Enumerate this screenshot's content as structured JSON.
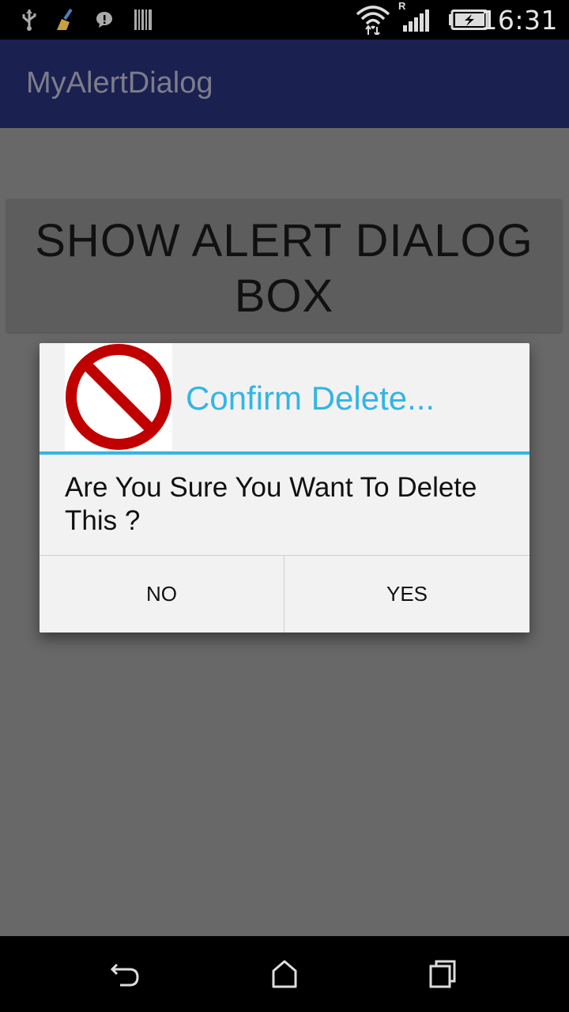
{
  "status_bar": {
    "time": "16:31",
    "roaming_indicator": "R",
    "icons": [
      "usb-icon",
      "cleaner-icon",
      "message-icon",
      "barcode-icon",
      "wifi-icon",
      "signal-icon",
      "battery-charging-icon"
    ]
  },
  "app_bar": {
    "title": "MyAlertDialog"
  },
  "main": {
    "show_dialog_button_label": "SHOW ALERT DIALOG BOX"
  },
  "dialog": {
    "icon": "no-entry-icon",
    "title": "Confirm Delete...",
    "message": "Are You Sure You Want To Delete This ?",
    "negative_label": "NO",
    "positive_label": "YES",
    "accent_color": "#33b5e5"
  },
  "nav_bar": {
    "icons": [
      "back-icon",
      "home-icon",
      "recents-icon"
    ]
  }
}
